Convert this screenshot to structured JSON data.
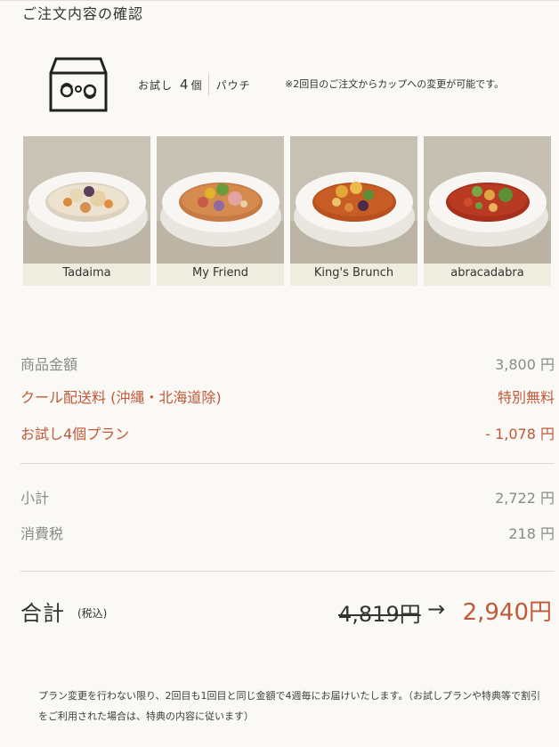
{
  "page": {
    "title": "ご注文内容の確認"
  },
  "plan": {
    "icon": "box-icon",
    "name": "お試し",
    "count": "4",
    "unit": "個",
    "package": "パウチ",
    "note": "※2回目のご注文からカップへの変更が可能です。"
  },
  "products": [
    {
      "name": "Tadaima"
    },
    {
      "name": "My Friend"
    },
    {
      "name": "King's Brunch"
    },
    {
      "name": "abracadabra"
    }
  ],
  "lines": {
    "subtotal_items": {
      "label": "商品金額",
      "value": "3,800 円"
    },
    "shipping": {
      "label": "クール配送料 (沖縄・北海道除)",
      "value": "特別無料"
    },
    "discount": {
      "label": "お試し4個プラン",
      "value": "- 1,078 円"
    },
    "subtotal": {
      "label": "小計",
      "value": "2,722 円"
    },
    "tax": {
      "label": "消費税",
      "value": "218 円"
    }
  },
  "total": {
    "label": "合計",
    "tax_note": "(税込)",
    "old_price": "4,819円",
    "arrow": "→",
    "new_price": "2,940円"
  },
  "footnote": "プラン変更を行わない限り、2回目も1回目と同じ金額で4週毎にお届けいたします。（お試しプランや特典等で割引をご利用された場合は、特典の内容に従います）",
  "colors": {
    "accent": "#c0593a",
    "background": "#faf9f5",
    "card": "#efece0"
  }
}
